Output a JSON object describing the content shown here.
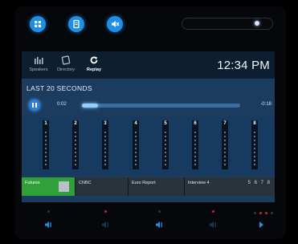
{
  "top_bar": {
    "icons": [
      "grid-icon",
      "document-icon",
      "mute-icon"
    ],
    "accent": "#1f8fe6"
  },
  "toolbar": {
    "speakers_label": "Speakers",
    "directory_label": "Directory",
    "replay_label": "Replay",
    "clock": "12:34 PM"
  },
  "replay": {
    "heading": "LAST 20 SECONDS",
    "elapsed": "0:02",
    "remaining": "-0:18",
    "progress": 0.1
  },
  "channels": {
    "labels": [
      "1",
      "2",
      "3",
      "4",
      "5",
      "6",
      "7",
      "8"
    ]
  },
  "sources": {
    "items": [
      {
        "label": "Futures",
        "active": true
      },
      {
        "label": "CNBC",
        "active": false
      },
      {
        "label": "Euro Report",
        "active": false
      },
      {
        "label": "Interview 4",
        "active": false
      }
    ],
    "page_numbers": "5 6 7 8"
  },
  "colors": {
    "screen_bg": "#1c3c5f",
    "active_tab": "#2fa03a",
    "indicator_red": "#d0212b"
  }
}
